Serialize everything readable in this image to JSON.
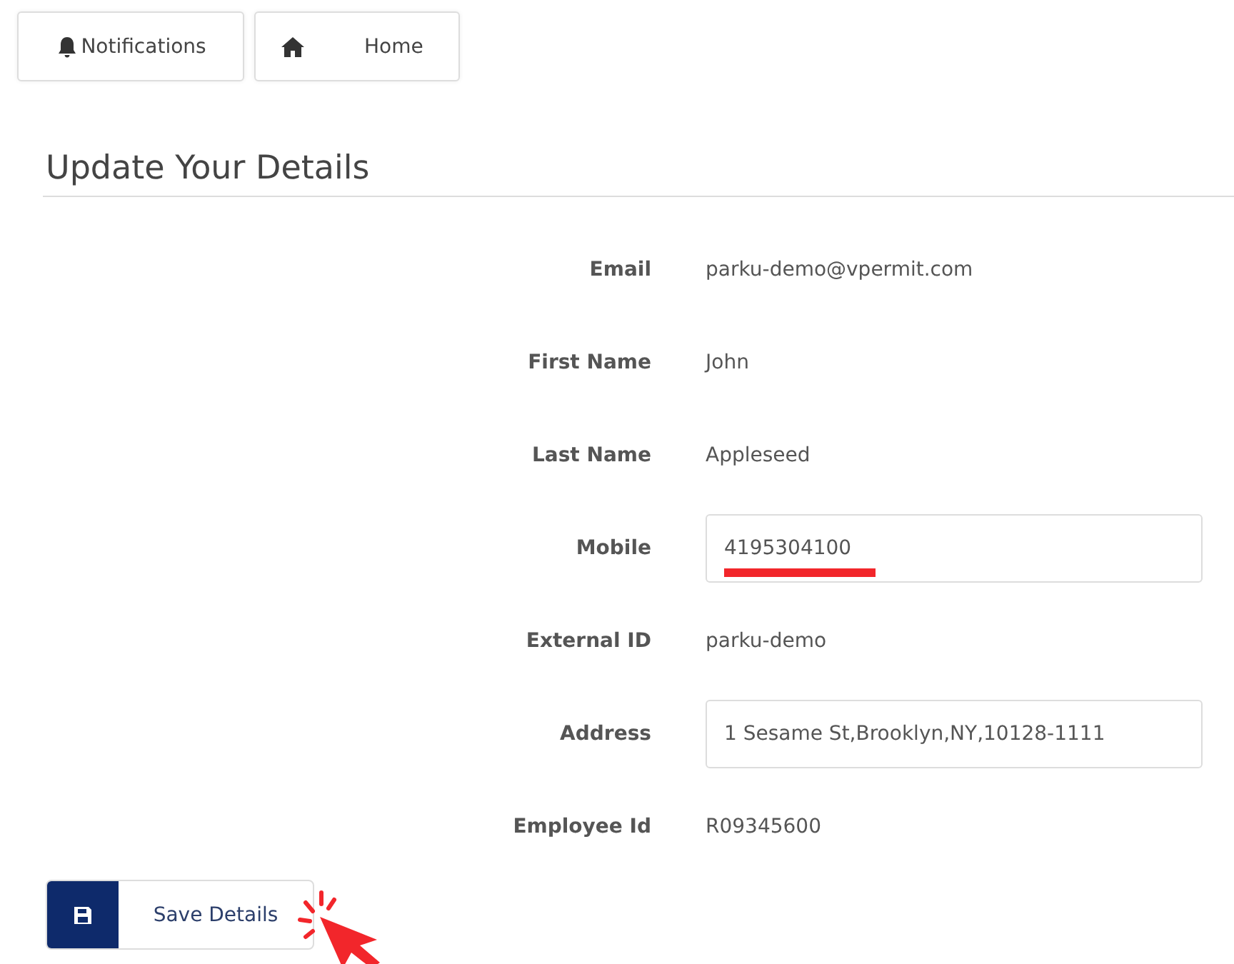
{
  "nav_buttons": [
    {
      "kind": "bell",
      "label": "Notifications"
    },
    {
      "kind": "home",
      "label": "Home"
    }
  ],
  "heading": "Update Your Details",
  "fields": [
    {
      "kind": "text",
      "label": "Email",
      "value": "parku-demo@vpermit.com"
    },
    {
      "kind": "text",
      "label": "First Name",
      "value": "John"
    },
    {
      "kind": "text",
      "label": "Last Name",
      "value": "Appleseed"
    },
    {
      "kind": "input",
      "label": "Mobile",
      "value": "4195304100",
      "underlined": true
    },
    {
      "kind": "text",
      "label": "External ID",
      "value": "parku-demo"
    },
    {
      "kind": "input",
      "label": "Address",
      "value": "1 Sesame St,Brooklyn,NY,10128-1111",
      "underlined": false
    },
    {
      "kind": "text",
      "label": "Employee Id",
      "value": "R09345600"
    }
  ],
  "save_button": {
    "label": "Save Details"
  }
}
